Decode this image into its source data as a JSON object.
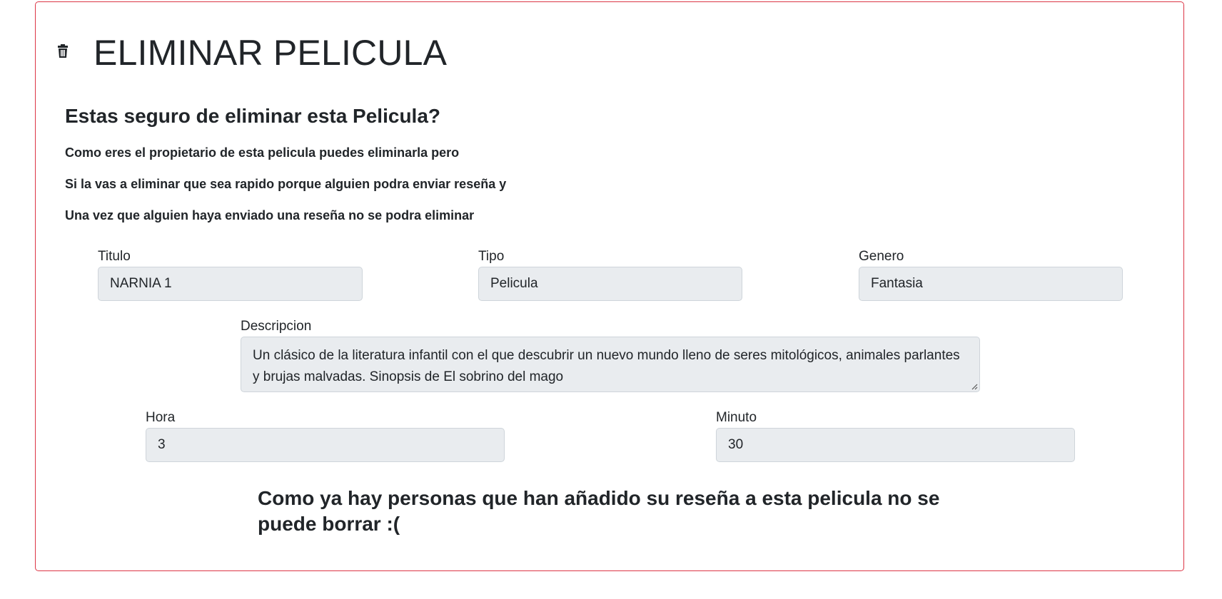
{
  "page": {
    "title": "ELIMINAR PELICULA",
    "icon": "trash-icon",
    "border_color": "#dc3545"
  },
  "confirm": {
    "heading": "Estas seguro de eliminar esta Pelicula?",
    "lines": [
      "Como eres el propietario de esta pelicula puedes eliminarla pero",
      "Si la vas a eliminar que sea rapido porque alguien podra enviar reseña y",
      "Una vez que alguien haya enviado una reseña no se podra eliminar"
    ]
  },
  "form": {
    "titulo": {
      "label": "Titulo",
      "value": "NARNIA 1"
    },
    "tipo": {
      "label": "Tipo",
      "value": "Pelicula"
    },
    "genero": {
      "label": "Genero",
      "value": "Fantasia"
    },
    "descripcion": {
      "label": "Descripcion",
      "value": "Un clásico de la literatura infantil con el que descubrir un nuevo mundo lleno de seres mitológicos, animales parlantes y brujas malvadas. Sinopsis de El sobrino del mago"
    },
    "hora": {
      "label": "Hora",
      "value": "3"
    },
    "minuto": {
      "label": "Minuto",
      "value": "30"
    }
  },
  "notice": "Como ya hay personas que han añadido su reseña a esta pelicula no se puede borrar :("
}
